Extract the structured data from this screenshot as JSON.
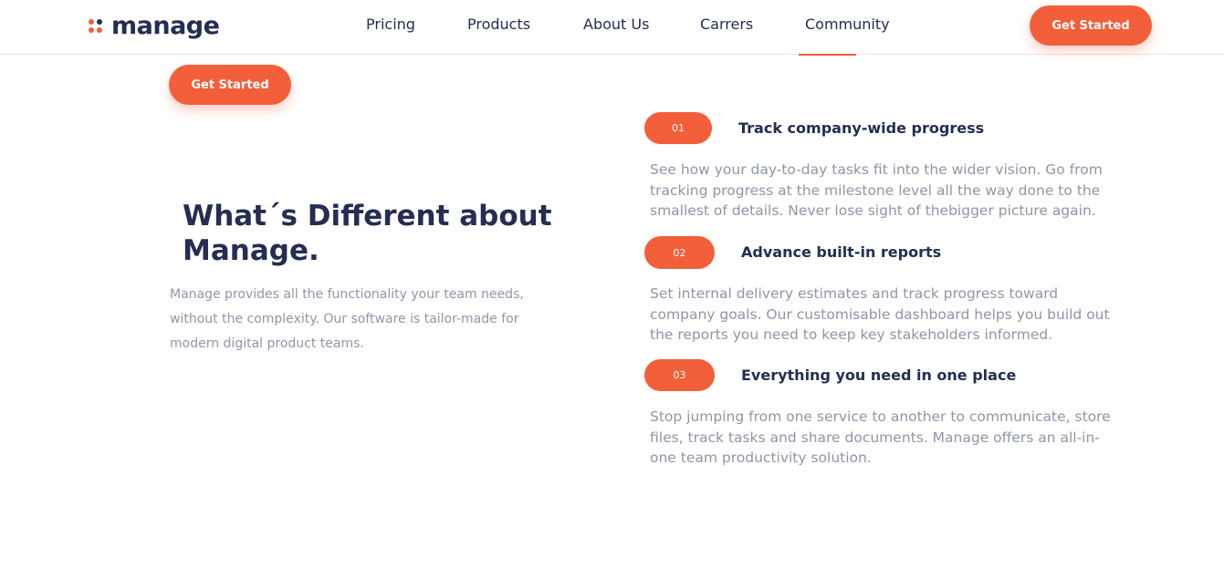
{
  "brand": {
    "name": "manage",
    "accent_color": "#f25f3a",
    "dark_color": "#242d52"
  },
  "nav": {
    "links": [
      {
        "label": "Pricing"
      },
      {
        "label": "Products"
      },
      {
        "label": "About Us"
      },
      {
        "label": "Carrers"
      },
      {
        "label": "Community"
      }
    ],
    "cta_label": "Get Started"
  },
  "hero": {
    "cta_label": "Get Started",
    "heading": "What´s Different about Manage.",
    "description": "Manage provides all the functionality your team needs, without the complexity. Our software is tailor-made for modern digital product teams."
  },
  "features": [
    {
      "number": "01",
      "title": "Track company-wide progress",
      "text": "See how your day-to-day tasks fit into the wider vision. Go from tracking progress at the milestone level all the way done to the smallest of details. Never lose sight of thebigger picture again."
    },
    {
      "number": "02",
      "title": "Advance built-in reports",
      "text": "Set internal delivery estimates and track progress toward company goals. Our customisable dashboard helps you build out the reports you need to keep key stakeholders informed."
    },
    {
      "number": "03",
      "title": "Everything you need in one place",
      "text": "Stop jumping from one service to another to communicate, store files, track tasks and share documents. Manage offers an all-in-one team productivity solution."
    }
  ]
}
